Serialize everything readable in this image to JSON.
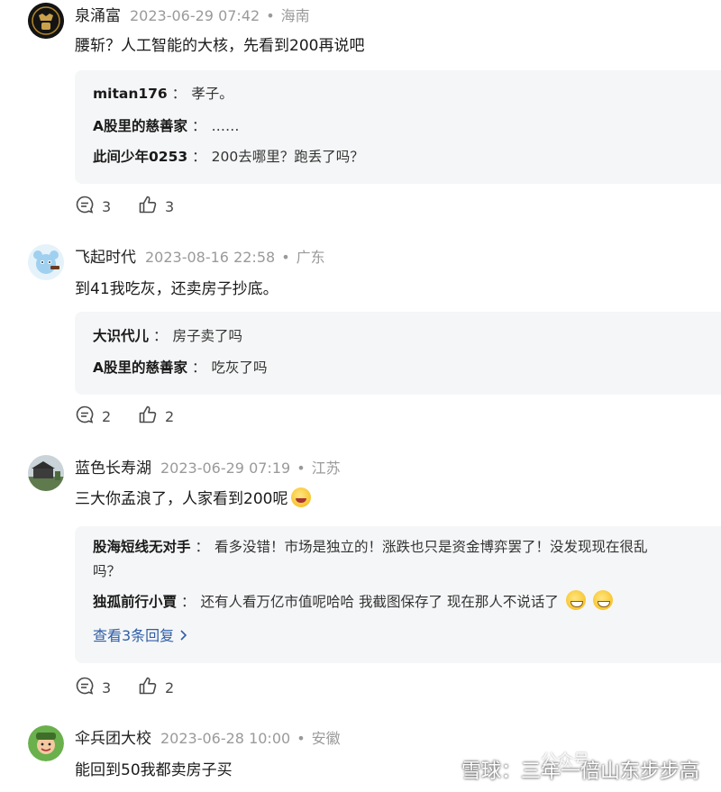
{
  "comments": [
    {
      "author": "泉涌富",
      "date": "2023-06-29 07:42",
      "sep": "•",
      "location": "海南",
      "text": "腰斩？人工智能的大核，先看到200再说吧",
      "replies": [
        {
          "name": "mitan176",
          "colon": "：",
          "text": "孝子。"
        },
        {
          "name": "A股里的慈善家",
          "colon": "：",
          "text": "……"
        },
        {
          "name": "此间少年0253",
          "colon": "：",
          "text": "200去哪里？跑丢了吗？"
        }
      ],
      "comment_count": "3",
      "like_count": "3"
    },
    {
      "author": "飞起时代",
      "date": "2023-08-16 22:58",
      "sep": "•",
      "location": "广东",
      "text": "到41我吃灰，还卖房子抄底。",
      "replies": [
        {
          "name": "大识代儿",
          "colon": "：",
          "text": "房子卖了吗"
        },
        {
          "name": "A股里的慈善家",
          "colon": "：",
          "text": "吃灰了吗"
        }
      ],
      "comment_count": "2",
      "like_count": "2"
    },
    {
      "author": "蓝色长寿湖",
      "date": "2023-06-29 07:19",
      "sep": "•",
      "location": "江苏",
      "text": "三大你孟浪了，人家看到200呢",
      "replies": [
        {
          "name": "股海短线无对手",
          "colon": "：",
          "text": "看多没错！市场是独立的！涨跌也只是资金博弈罢了！没发现现在很乱",
          "text_line2": "吗？"
        },
        {
          "name": "独孤前行小賈",
          "colon": "：",
          "text": "还有人看万亿市值呢哈哈 我截图保存了 现在那人不说话了"
        }
      ],
      "more_replies": "查看3条回复",
      "comment_count": "3",
      "like_count": "2"
    },
    {
      "author": "伞兵团大校",
      "date": "2023-06-28 10:00",
      "sep": "•",
      "location": "安徽",
      "text": "能回到50我都卖房子买"
    }
  ],
  "watermark": "雪球：三年一倍山东步步高",
  "watermark_overlay": "公众号",
  "icons": {
    "comment": "comment-bubble-icon",
    "like": "thumbs-up-icon",
    "emoji": "laughing-face-icon",
    "chevron": "chevron-right-icon"
  },
  "colors": {
    "reply_bg": "#f5f6f7",
    "link": "#2f5ea8",
    "muted": "#9a9a9a"
  }
}
